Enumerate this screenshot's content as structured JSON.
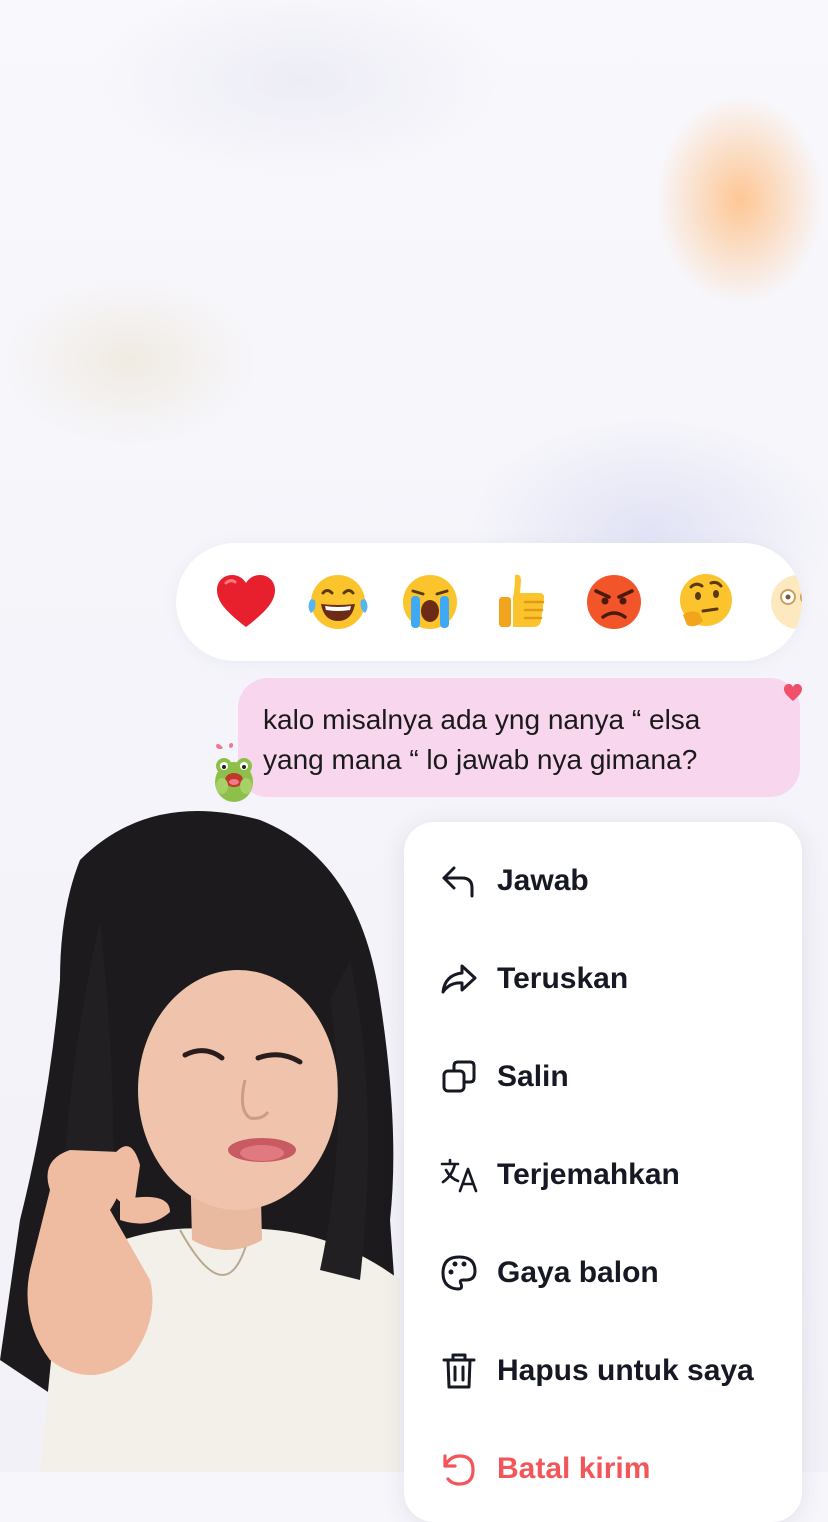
{
  "reactions": [
    {
      "icon": "red-heart-emoji"
    },
    {
      "icon": "tears-of-joy-emoji"
    },
    {
      "icon": "loudly-crying-emoji"
    },
    {
      "icon": "thumbs-up-emoji"
    },
    {
      "icon": "angry-face-emoji"
    },
    {
      "icon": "thinking-face-emoji"
    },
    {
      "icon": "astonished-face-emoji"
    }
  ],
  "message": {
    "line1": "kalo misalnya ada yng nanya “ elsa",
    "line2": "yang mana “ lo jawab nya gimana?",
    "bubble_color": "#f7d6ee"
  },
  "menu": {
    "items": [
      {
        "label": "Jawab",
        "icon": "reply-icon"
      },
      {
        "label": "Teruskan",
        "icon": "forward-icon"
      },
      {
        "label": "Salin",
        "icon": "copy-icon"
      },
      {
        "label": "Terjemahkan",
        "icon": "translate-icon"
      },
      {
        "label": "Gaya balon",
        "icon": "palette-icon"
      },
      {
        "label": "Hapus untuk saya",
        "icon": "trash-icon"
      },
      {
        "label": "Batal kirim",
        "icon": "undo-icon"
      }
    ]
  },
  "colors": {
    "danger": "#f2555a",
    "text": "#161823"
  }
}
